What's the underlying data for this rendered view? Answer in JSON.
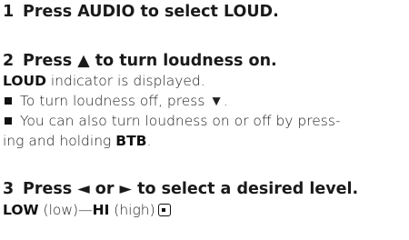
{
  "steps": [
    {
      "number": "1",
      "heading": "Press AUDIO to select LOUD."
    },
    {
      "number": "2",
      "heading": "Press ▲ to turn loudness on.",
      "result_bold": "LOUD",
      "result_text": " indicator is displayed.",
      "bullets": [
        {
          "text": "To turn loudness off, press ▼."
        },
        {
          "text": "You can also turn loudness on or off by press-",
          "continuation": "ing and holding ",
          "continuation_bold": "BTB",
          "continuation_end": "."
        }
      ]
    },
    {
      "number": "3",
      "heading": "Press ◄ or ► to select a desired level.",
      "range_low_bold": "LOW",
      "range_low_text": " (low)—",
      "range_high_bold": "HI",
      "range_high_text": " (high)"
    }
  ],
  "icons": {
    "bullet": "square-bullet-icon",
    "end_mark": "end-of-section-icon"
  }
}
